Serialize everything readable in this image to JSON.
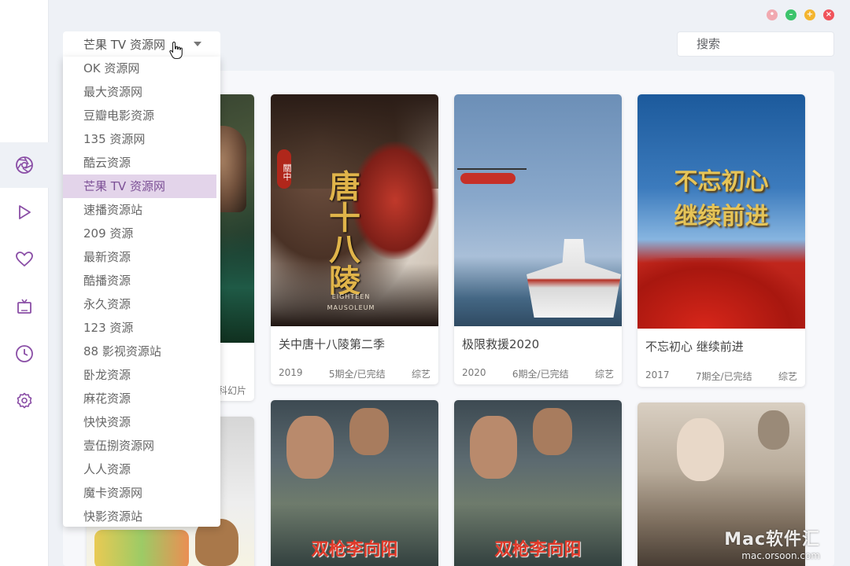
{
  "window": {
    "controls": [
      "pin",
      "minimize",
      "maximize",
      "close"
    ]
  },
  "sidebar": {
    "items": [
      {
        "icon": "aperture-icon",
        "active": true
      },
      {
        "icon": "play-icon",
        "active": false
      },
      {
        "icon": "heart-icon",
        "active": false
      },
      {
        "icon": "tv-icon",
        "active": false
      },
      {
        "icon": "clock-icon",
        "active": false
      },
      {
        "icon": "gear-icon",
        "active": false
      }
    ]
  },
  "source": {
    "selected": "芒果 TV 资源网",
    "options": [
      "OK 资源网",
      "最大资源网",
      "豆瓣电影资源",
      "135 资源网",
      "酷云资源",
      "芒果 TV 资源网",
      "速播资源站",
      "209 资源",
      "最新资源",
      "酷播资源",
      "永久资源",
      "123 资源",
      "88 影视资源站",
      "卧龙资源",
      "麻花资源",
      "快快资源",
      "壹伍捌资源网",
      "人人资源",
      "魔卡资源网",
      "快影资源站"
    ],
    "highlighted_index": 5
  },
  "search": {
    "placeholder": "搜索"
  },
  "videos": [
    {
      "title": "关中唐十八陵第二季",
      "year": "2019",
      "episodes": "5期全/已完结",
      "category": "综艺"
    },
    {
      "title": "极限救援2020",
      "year": "2020",
      "episodes": "6期全/已完结",
      "category": "综艺"
    },
    {
      "title": "不忘初心 继续前进",
      "year": "2017",
      "episodes": "7期全/已完结",
      "category": "综艺"
    }
  ],
  "partial_card": {
    "tag_text": "科幻片"
  },
  "posters": {
    "tang_title": "唐十八陵",
    "tang_badge": "關中",
    "tang_sub": "EIGHTEEN MAUSOLEUM",
    "chuxin_line1": "不忘初心",
    "chuxin_line2": "继续前进",
    "shuangqiang": "双枪李向阳"
  },
  "watermark": {
    "brand": "Mac软件汇",
    "url": "mac.orsoon.com"
  },
  "colors": {
    "accent": "#7c5096",
    "selected_bg": "#e3d4ea",
    "close": "#f0535b",
    "min": "#3cc46c",
    "max": "#f4b52f"
  }
}
